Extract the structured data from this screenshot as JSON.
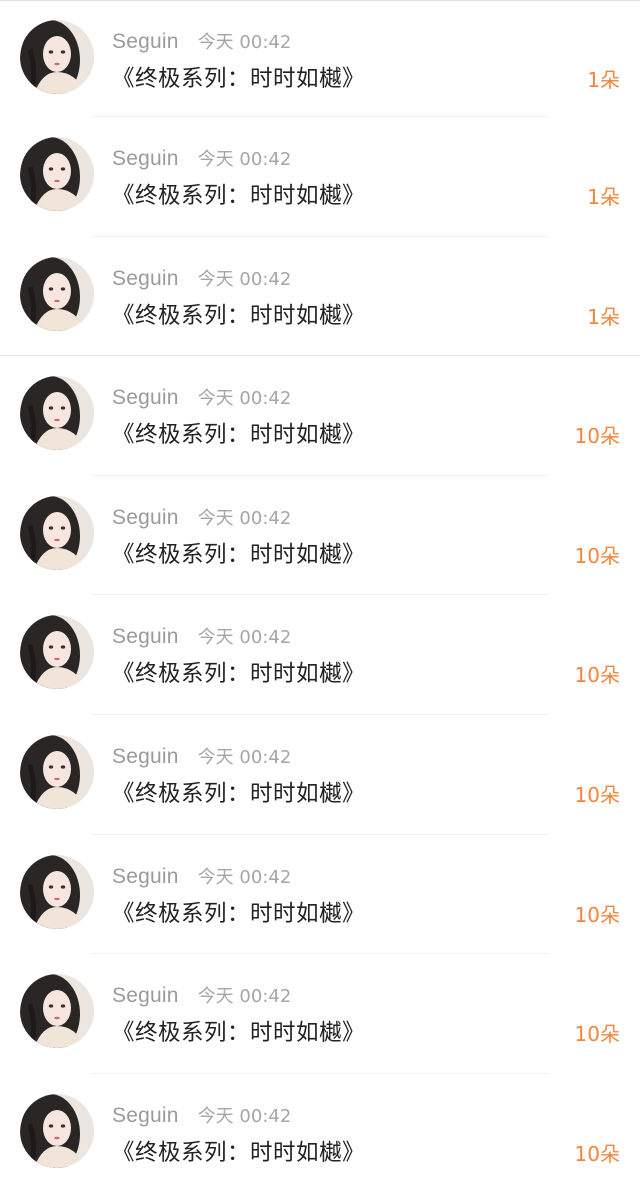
{
  "items": [
    {
      "name": "Seguin",
      "time": "今天 00:42",
      "title": "《终极系列：时时如樾》",
      "count": "1朵",
      "avatar_icon": "user-avatar-icon"
    },
    {
      "name": "Seguin",
      "time": "今天 00:42",
      "title": "《终极系列：时时如樾》",
      "count": "1朵",
      "avatar_icon": "user-avatar-icon"
    },
    {
      "name": "Seguin",
      "time": "今天 00:42",
      "title": "《终极系列：时时如樾》",
      "count": "1朵",
      "avatar_icon": "user-avatar-icon"
    },
    {
      "name": "Seguin",
      "time": "今天 00:42",
      "title": "《终极系列：时时如樾》",
      "count": "10朵",
      "avatar_icon": "user-avatar-icon"
    },
    {
      "name": "Seguin",
      "time": "今天 00:42",
      "title": "《终极系列：时时如樾》",
      "count": "10朵",
      "avatar_icon": "user-avatar-icon"
    },
    {
      "name": "Seguin",
      "time": "今天 00:42",
      "title": "《终极系列：时时如樾》",
      "count": "10朵",
      "avatar_icon": "user-avatar-icon"
    },
    {
      "name": "Seguin",
      "time": "今天 00:42",
      "title": "《终极系列：时时如樾》",
      "count": "10朵",
      "avatar_icon": "user-avatar-icon"
    },
    {
      "name": "Seguin",
      "time": "今天 00:42",
      "title": "《终极系列：时时如樾》",
      "count": "10朵",
      "avatar_icon": "user-avatar-icon"
    },
    {
      "name": "Seguin",
      "time": "今天 00:42",
      "title": "《终极系列：时时如樾》",
      "count": "10朵",
      "avatar_icon": "user-avatar-icon"
    },
    {
      "name": "Seguin",
      "time": "今天 00:42",
      "title": "《终极系列：时时如樾》",
      "count": "10朵",
      "avatar_icon": "user-avatar-icon"
    }
  ],
  "colors": {
    "accent": "#f4853a",
    "name": "#9b9b9b",
    "time": "#a6a6a6",
    "title": "#222222"
  }
}
